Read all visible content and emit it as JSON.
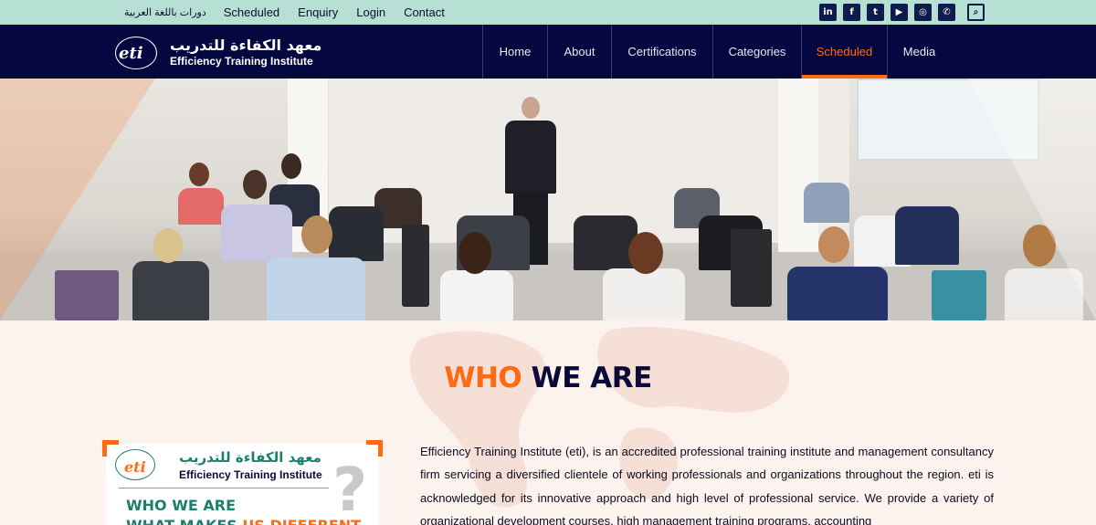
{
  "topbar": {
    "links": [
      {
        "label": "دورات باللغة العربية"
      },
      {
        "label": "Scheduled"
      },
      {
        "label": "Enquiry"
      },
      {
        "label": "Login"
      },
      {
        "label": "Contact"
      }
    ],
    "social_icons": [
      {
        "name": "linkedin-icon",
        "glyph": "in"
      },
      {
        "name": "facebook-icon",
        "glyph": "f"
      },
      {
        "name": "twitter-icon",
        "glyph": "t"
      },
      {
        "name": "youtube-icon",
        "glyph": "▶"
      },
      {
        "name": "instagram-icon",
        "glyph": "◎"
      },
      {
        "name": "whatsapp-icon",
        "glyph": "✆"
      },
      {
        "name": "search-icon",
        "glyph": "⌕"
      }
    ]
  },
  "logo": {
    "arabic": "معهد الكفاءة للتدريب",
    "english": "Efficiency Training Institute",
    "mark": "eti"
  },
  "nav": {
    "items": [
      {
        "label": "Home"
      },
      {
        "label": "About"
      },
      {
        "label": "Certifications"
      },
      {
        "label": "Categories"
      },
      {
        "label": "Scheduled",
        "active": true
      },
      {
        "label": "Media"
      }
    ]
  },
  "who": {
    "heading_1": "WHO",
    "heading_2": "WE ARE",
    "card": {
      "arabic": "معهد الكفاءة للتدريب",
      "english": "Efficiency Training Institute",
      "mark": "eti",
      "line1": "WHO WE ARE",
      "line2_a": "WHAT MAKES ",
      "line2_b": "US DIFFERENT",
      "question": "?"
    },
    "text": "Efficiency Training Institute (eti), is an accredited professional training institute and management consultancy firm servicing a diversified clientele of working professionals and organizations throughout the region. eti is acknowledged for its innovative approach and high level of professional service. We provide a variety of organizational development courses, high management training programs, accounting"
  },
  "colors": {
    "accent": "#ff6a13",
    "navy": "#050740",
    "topbar": "#b7e0d5",
    "teal": "#1b7f6c"
  }
}
